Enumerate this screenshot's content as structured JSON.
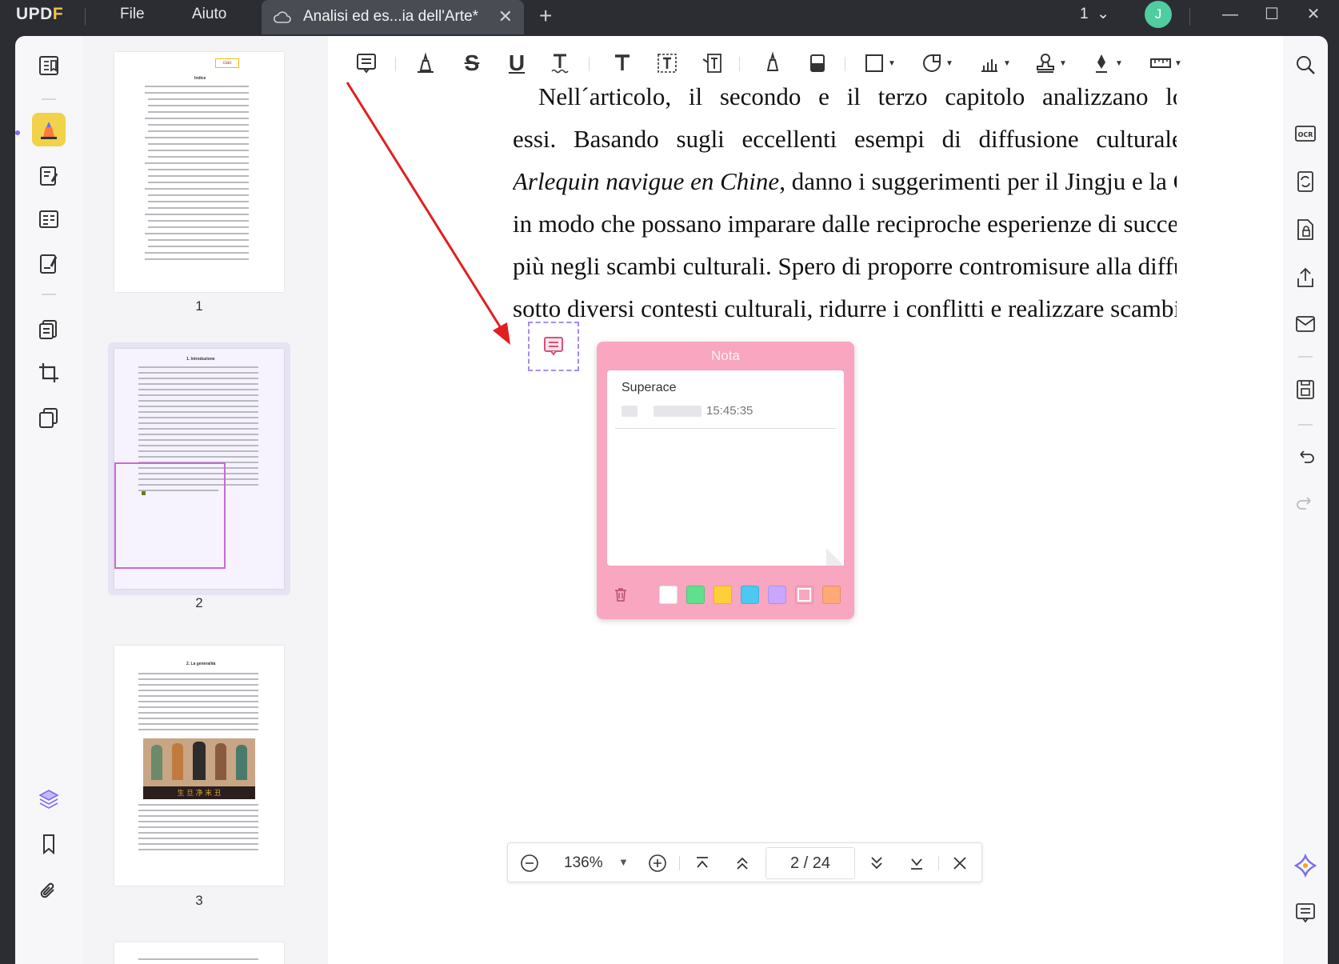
{
  "app": {
    "brand": "UPDF",
    "menu": {
      "file": "File",
      "help": "Aiuto"
    },
    "tab_title": "Analisi ed es...ia dell'Arte*",
    "page_indicator": "1",
    "avatar_initial": "J"
  },
  "thumbnails": [
    {
      "number": "1"
    },
    {
      "number": "2"
    },
    {
      "number": "3"
    }
  ],
  "thumb_extra": {
    "toc_label": "ciao",
    "toc_title": "Indice",
    "page2_heading": "1. Introduzione",
    "page3_heading": "2. La generalità",
    "page3_caption": "生 旦 净 末 丑"
  },
  "document": {
    "line1": "Nell´articolo, il secondo e il terzo capitolo analizzano lo svilupp",
    "line2": "essi. Basando sugli eccellenti esempi di diffusione culturale c",
    "line3_italic": "Arlequin navigue en Chine",
    "line3_rest": ", danno i suggerimenti per il Jingju e la C",
    "line4": "in modo che possano imparare dalle reciproche esperienze di succe",
    "line5": "più negli scambi culturali. Spero di proporre contromisure alla diffu",
    "line6": "sotto diversi contesti culturali, ridurre i conflitti e realizzare scambi"
  },
  "note": {
    "title": "Nota",
    "author": "Superace",
    "time": "15:45:35",
    "colors": [
      "#ffffff",
      "#5fe08f",
      "#ffcf3a",
      "#4cc9f0",
      "#c9a6ff",
      "#f9a6c0",
      "#ffa878"
    ],
    "selected_color": "#f9a6c0"
  },
  "zoom": {
    "level": "136%",
    "current_page": "2",
    "total_pages": "24",
    "page_display": "2  /  24"
  },
  "colors": {
    "titlebar_bg": "#2b2d33",
    "accent_highlight": "#f1d24a",
    "note_pink": "#f9a6c0",
    "arrow_red": "#e02020",
    "avatar_green": "#4fcca0"
  }
}
